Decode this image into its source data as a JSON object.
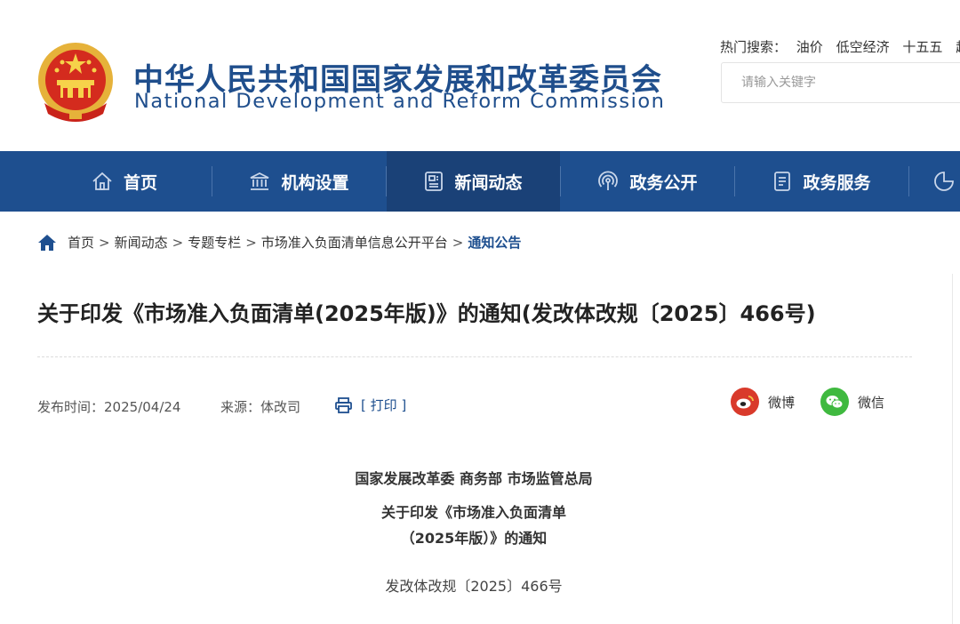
{
  "header": {
    "title_cn": "中华人民共和国国家发展和改革委员会",
    "title_en": "National Development and Reform Commission",
    "hot_label": "热门搜索：",
    "hot_keywords": [
      "油价",
      "低空经济",
      "十五五",
      "超长"
    ],
    "search_placeholder": "请输入关键字",
    "emblem_icon": "national-emblem-icon"
  },
  "nav": {
    "items": [
      {
        "label": "首页",
        "icon": "home-icon"
      },
      {
        "label": "机构设置",
        "icon": "institution-icon"
      },
      {
        "label": "新闻动态",
        "icon": "news-icon",
        "active": true
      },
      {
        "label": "政务公开",
        "icon": "broadcast-icon"
      },
      {
        "label": "政务服务",
        "icon": "document-icon"
      }
    ],
    "colors": {
      "bar": "#1e4f8f",
      "active": "#1a4177"
    }
  },
  "breadcrumb": {
    "sep": ">",
    "items": [
      "首页",
      "新闻动态",
      "专题专栏",
      "市场准入负面清单信息公开平台"
    ],
    "current": "通知公告"
  },
  "article": {
    "title": "关于印发《市场准入负面清单(2025年版)》的通知(发改体改规〔2025〕466号)",
    "publish_label": "发布时间：",
    "publish_date": "2025/04/24",
    "source_label": "来源：",
    "source": "体改司",
    "print_label": "[ 打印 ]",
    "share": [
      {
        "label": "微博",
        "icon": "weibo-icon",
        "color": "#d93a2b"
      },
      {
        "label": "微信",
        "icon": "wechat-icon",
        "color": "#3fb93f"
      }
    ],
    "issuers": "国家发展改革委 商务部 市场监管总局",
    "heading_line1": "关于印发《市场准入负面清单",
    "heading_line2": "（2025年版）》的通知",
    "doc_number": "发改体改规〔2025〕466号"
  }
}
